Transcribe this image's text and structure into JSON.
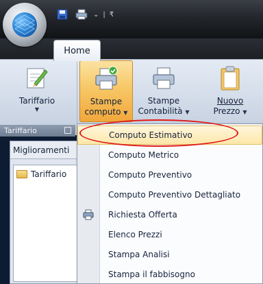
{
  "tabs": {
    "home": "Home"
  },
  "ribbon": {
    "tariffario": {
      "label": "Tariffario"
    },
    "stampe_computo": {
      "line1": "Stampe",
      "line2": "computo"
    },
    "stampe_contabilita": {
      "line1": "Stampe",
      "line2": "Contabilità"
    },
    "nuovo_prezzo": {
      "line1": "Nuovo",
      "line2": "Prezzo"
    },
    "group_label": "Tariffario"
  },
  "panel": {
    "tab_label": "Miglioramenti",
    "tree_item": "Tariffario"
  },
  "menu": {
    "items": [
      {
        "label": "Computo Estimativo",
        "highlighted": true
      },
      {
        "label": "Computo Metrico"
      },
      {
        "label": "Computo Preventivo"
      },
      {
        "label": "Computo Preventivo Dettagliato"
      },
      {
        "label": "Richiesta Offerta",
        "icon": "printer-icon"
      },
      {
        "label": "Elenco Prezzi"
      },
      {
        "label": "Stampa Analisi"
      },
      {
        "label": "Stampa il fabbisogno"
      }
    ]
  },
  "colors": {
    "highlight_ring": "#e01818",
    "active_button": "#f7c766",
    "workspace": "#0d1b33"
  }
}
